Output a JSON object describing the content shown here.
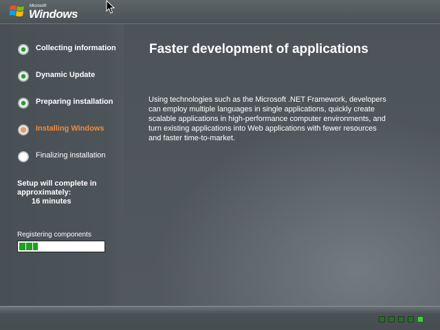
{
  "header": {
    "logo_small": "Microsoft",
    "logo_text": "Windows"
  },
  "steps": [
    {
      "label": "Collecting information",
      "state": "done"
    },
    {
      "label": "Dynamic Update",
      "state": "done"
    },
    {
      "label": "Preparing installation",
      "state": "done"
    },
    {
      "label": "Installing Windows",
      "state": "current"
    },
    {
      "label": "Finalizing installation",
      "state": "pending"
    }
  ],
  "eta": {
    "text": "Setup will complete in approximately:",
    "time": "16 minutes"
  },
  "progress": {
    "label": "Registering components",
    "fraction": 0.22
  },
  "content": {
    "headline": "Faster development of applications",
    "body": "Using technologies such as the Microsoft .NET Framework, developers can employ multiple languages in single applications, quickly create scalable applications in high-performance computer environments, and turn existing applications into Web applications with fewer resources and faster time-to-market."
  },
  "activity_indicator": {
    "count": 5,
    "active_index": 4
  },
  "colors": {
    "current_step": "#f08c3a",
    "progress_fill": "#1fa11f",
    "background": "#4b5257"
  }
}
